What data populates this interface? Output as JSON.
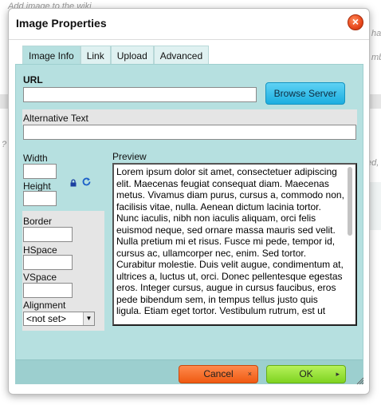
{
  "background": {
    "top_text": "Add image to the wiki",
    "right_texts": [
      "ha",
      "mbe",
      "ed, a"
    ],
    "left_text": "?"
  },
  "dialog": {
    "title": "Image Properties",
    "close_symbol": "×"
  },
  "tabs": [
    {
      "label": "Image Info",
      "active": true
    },
    {
      "label": "Link",
      "active": false
    },
    {
      "label": "Upload",
      "active": false
    },
    {
      "label": "Advanced",
      "active": false
    }
  ],
  "fields": {
    "url_label": "URL",
    "url_value": "",
    "browse_label": "Browse Server",
    "alt_label": "Alternative Text",
    "alt_value": "",
    "width_label": "Width",
    "width_value": "",
    "height_label": "Height",
    "height_value": "",
    "border_label": "Border",
    "border_value": "",
    "hspace_label": "HSpace",
    "hspace_value": "",
    "vspace_label": "VSpace",
    "vspace_value": "",
    "alignment_label": "Alignment",
    "alignment_value": "<not set>"
  },
  "preview": {
    "label": "Preview",
    "text": "Lorem ipsum dolor sit amet, consectetuer adipiscing elit. Maecenas feugiat consequat diam. Maecenas metus. Vivamus diam purus, cursus a, commodo non, facilisis vitae, nulla. Aenean dictum lacinia tortor. Nunc iaculis, nibh non iaculis aliquam, orci felis euismod neque, sed ornare massa mauris sed velit. Nulla pretium mi et risus. Fusce mi pede, tempor id, cursus ac, ullamcorper nec, enim. Sed tortor. Curabitur molestie. Duis velit augue, condimentum at, ultrices a, luctus ut, orci. Donec pellentesque egestas eros. Integer cursus, augue in cursus faucibus, eros pede bibendum sem, in tempus tellus justo quis ligula. Etiam eget tortor. Vestibulum rutrum, est ut"
  },
  "footer": {
    "cancel_label": "Cancel",
    "cancel_glyph": "×",
    "ok_label": "OK",
    "ok_glyph": "▸"
  },
  "colors": {
    "panel_bg": "#b6e0e0",
    "browse_button": "#1aaee0",
    "cancel_button": "#ef5a12",
    "ok_button": "#7ed321",
    "close_button": "#e8471c"
  }
}
